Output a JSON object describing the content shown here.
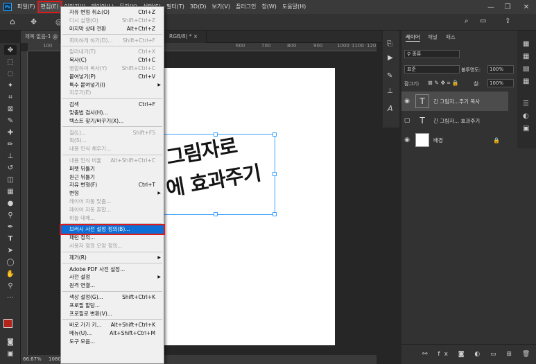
{
  "menubar": {
    "items": [
      {
        "label": "파일(F)",
        "active": false
      },
      {
        "label": "편집(E)",
        "active": true
      },
      {
        "label": "이미지(I)",
        "active": false
      },
      {
        "label": "레이어(L)",
        "active": false
      },
      {
        "label": "문자(Y)",
        "active": false
      },
      {
        "label": "선택(S)",
        "active": false
      },
      {
        "label": "필터(T)",
        "active": false
      },
      {
        "label": "3D(D)",
        "active": false
      },
      {
        "label": "보기(V)",
        "active": false
      },
      {
        "label": "플러그인",
        "active": false
      },
      {
        "label": "창(W)",
        "active": false
      },
      {
        "label": "도움말(H)",
        "active": false
      }
    ]
  },
  "tabs": {
    "doc_tab_1": "제목 없음-1 @",
    "doc_tab_2": "RGB/8) *  ×"
  },
  "ruler": {
    "h_ticks": [
      "100",
      "600",
      "700",
      "800",
      "900",
      "1000",
      "1100",
      "120"
    ]
  },
  "status": {
    "zoom": "66.67%",
    "size": "1080"
  },
  "canvas": {
    "line1": "그림자로",
    "line2": "에 효과주기"
  },
  "edit_menu": {
    "items": [
      {
        "label": "자유 변형 취소(O)",
        "shortcut": "Ctrl+Z",
        "disabled": false
      },
      {
        "label": "다시 실행(O)",
        "shortcut": "Shift+Ctrl+Z",
        "disabled": true
      },
      {
        "label": "마지막 상태 전환",
        "shortcut": "Alt+Ctrl+Z",
        "disabled": false
      },
      {
        "label": "희미하게 하기(D)...",
        "shortcut": "Shift+Ctrl+F",
        "disabled": true
      },
      {
        "label": "잘라내기(T)",
        "shortcut": "Ctrl+X",
        "disabled": true
      },
      {
        "label": "복사(C)",
        "shortcut": "Ctrl+C",
        "disabled": false
      },
      {
        "label": "병합하여 복사(Y)",
        "shortcut": "Shift+Ctrl+C",
        "disabled": true
      },
      {
        "label": "붙여넣기(P)",
        "shortcut": "Ctrl+V",
        "disabled": false
      },
      {
        "label": "특수 붙여넣기(I)",
        "shortcut": "",
        "disabled": false,
        "submenu": true
      },
      {
        "label": "지우기(E)",
        "shortcut": "",
        "disabled": true
      },
      {
        "label": "검색",
        "shortcut": "Ctrl+F",
        "disabled": false
      },
      {
        "label": "맞춤법 검사(H)...",
        "shortcut": "",
        "disabled": false
      },
      {
        "label": "텍스트 찾기/바꾸기(X)...",
        "shortcut": "",
        "disabled": false
      },
      {
        "label": "칠(L)...",
        "shortcut": "Shift+F5",
        "disabled": true
      },
      {
        "label": "획(S)...",
        "shortcut": "",
        "disabled": true
      },
      {
        "label": "내용 인식 채우기...",
        "shortcut": "",
        "disabled": true
      },
      {
        "label": "내용 인식 비율",
        "shortcut": "Alt+Shift+Ctrl+C",
        "disabled": true
      },
      {
        "label": "퍼펫 뒤틀기",
        "shortcut": "",
        "disabled": false
      },
      {
        "label": "원근 뒤틀기",
        "shortcut": "",
        "disabled": false
      },
      {
        "label": "자유 변형(F)",
        "shortcut": "Ctrl+T",
        "disabled": false
      },
      {
        "label": "변형",
        "shortcut": "",
        "disabled": false,
        "submenu": true
      },
      {
        "label": "레이어 자동 맞춤...",
        "shortcut": "",
        "disabled": true
      },
      {
        "label": "레이어 자동 혼합...",
        "shortcut": "",
        "disabled": true
      },
      {
        "label": "하늘 대체...",
        "shortcut": "",
        "disabled": true
      },
      {
        "label": "브러시 사전 설정 정의(B)...",
        "shortcut": "",
        "disabled": false,
        "highlight": true
      },
      {
        "label": "패턴 정의...",
        "shortcut": "",
        "disabled": false
      },
      {
        "label": "사용자 정의 모양 정의...",
        "shortcut": "",
        "disabled": true
      },
      {
        "label": "제거(R)",
        "shortcut": "",
        "disabled": false,
        "submenu": true
      },
      {
        "label": "Adobe PDF 사전 설정...",
        "shortcut": "",
        "disabled": false
      },
      {
        "label": "사전 설정",
        "shortcut": "",
        "disabled": false,
        "submenu": true
      },
      {
        "label": "원격 연결...",
        "shortcut": "",
        "disabled": false
      },
      {
        "label": "색상 설정(G)...",
        "shortcut": "Shift+Ctrl+K",
        "disabled": false
      },
      {
        "label": "프로필 할당...",
        "shortcut": "",
        "disabled": false
      },
      {
        "label": "프로필로 변환(V)...",
        "shortcut": "",
        "disabled": false
      },
      {
        "label": "바로 가기 키...",
        "shortcut": "Alt+Shift+Ctrl+K",
        "disabled": false
      },
      {
        "label": "메뉴(U)...",
        "shortcut": "Alt+Shift+Ctrl+M",
        "disabled": false
      },
      {
        "label": "도구 모음...",
        "shortcut": "",
        "disabled": false
      }
    ]
  },
  "layers_panel": {
    "tabs": [
      "레이어",
      "채널",
      "패스"
    ],
    "filter_label": "종류",
    "blend_mode": "표준",
    "opacity_label": "불투명도:",
    "opacity_value": "100%",
    "lock_label": "잠그기:",
    "fill_label": "칠:",
    "fill_value": "100%",
    "layers": [
      {
        "name": "긴 그림자...주기 복사",
        "type": "text",
        "selected": true,
        "visible": true
      },
      {
        "name": "긴 그림자... 효과주기",
        "type": "text",
        "selected": false,
        "visible": false
      },
      {
        "name": "배경",
        "type": "image",
        "selected": false,
        "visible": true,
        "locked": true
      }
    ]
  },
  "colors": {
    "accent": "#0d6fd6",
    "highlight_border": "#e01a1a",
    "foreground_color": "#b5221a"
  }
}
